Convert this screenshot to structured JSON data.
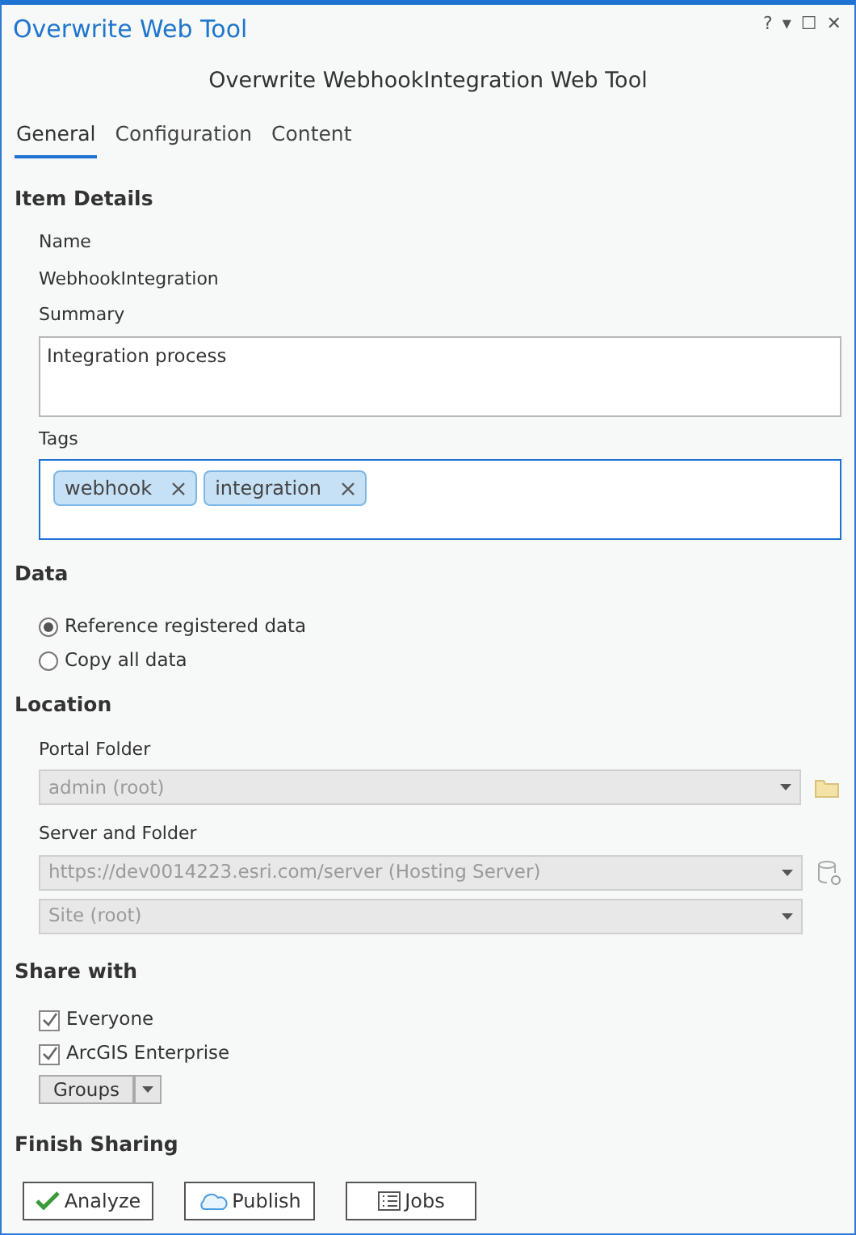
{
  "window": {
    "title": "Overwrite Web Tool",
    "controls": [
      "?",
      "▾",
      "☐",
      "✕"
    ]
  },
  "heading": "Overwrite WebhookIntegration Web Tool",
  "tabs": [
    {
      "label": "General",
      "selected": true
    },
    {
      "label": "Configuration",
      "selected": false
    },
    {
      "label": "Content",
      "selected": false
    }
  ],
  "item_details": {
    "title": "Item Details",
    "name_label": "Name",
    "name_value": "WebhookIntegration",
    "summary_label": "Summary",
    "summary": "Integration process",
    "tags_label": "Tags",
    "tags": [
      "webhook",
      "integration"
    ]
  },
  "data": {
    "title": "Data",
    "options": [
      {
        "label": "Reference registered data",
        "selected": true
      },
      {
        "label": "Copy all data",
        "selected": false
      }
    ]
  },
  "location": {
    "title": "Location",
    "portal_folder_label": "Portal Folder",
    "portal_folder": "admin (root)",
    "server_label": "Server and Folder",
    "server": "https://dev0014223.esri.com/server (Hosting Server)",
    "server_folder": "Site (root)",
    "disabled": true
  },
  "share": {
    "title": "Share with",
    "options": [
      {
        "label": "Everyone",
        "checked": true
      },
      {
        "label": "ArcGIS Enterprise",
        "checked": true
      }
    ],
    "groups_button": "Groups"
  },
  "finish": {
    "title": "Finish Sharing",
    "buttons": [
      {
        "kind": "analyze",
        "label": "Analyze"
      },
      {
        "kind": "publish",
        "label": "Publish"
      },
      {
        "kind": "jobs",
        "label": "Jobs"
      }
    ]
  }
}
